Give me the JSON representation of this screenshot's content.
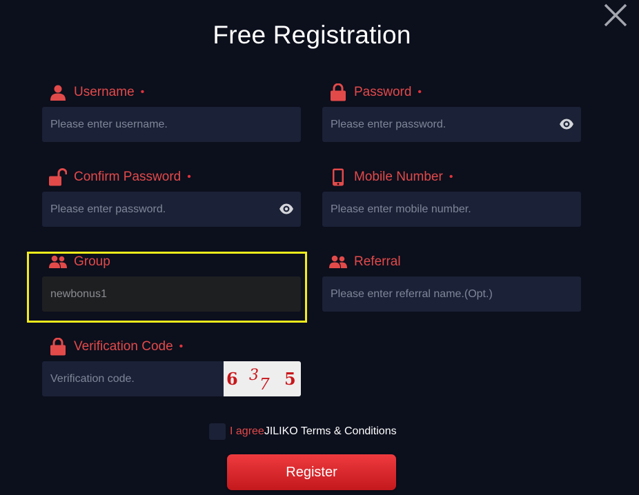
{
  "title": "Free Registration",
  "colors": {
    "background": "#0c0f1c",
    "input_bg": "#1b2136",
    "label": "#e24a4a",
    "highlight": "#f2ec1c",
    "button": "#d8262c"
  },
  "fields": {
    "username": {
      "label": "Username",
      "required": "•",
      "placeholder": "Please enter username.",
      "icon": "user-icon"
    },
    "password": {
      "label": "Password",
      "required": "•",
      "placeholder": "Please enter password.",
      "icon": "lock-icon"
    },
    "confirm_password": {
      "label": "Confirm Password",
      "required": "•",
      "placeholder": "Please enter password.",
      "icon": "unlock-icon"
    },
    "mobile": {
      "label": "Mobile Number",
      "required": "•",
      "placeholder": "Please enter mobile number.",
      "icon": "phone-icon"
    },
    "group": {
      "label": "Group",
      "value": "newbonus1",
      "icon": "users-icon"
    },
    "referral": {
      "label": "Referral",
      "placeholder": "Please enter referral name.(Opt.)",
      "icon": "users-icon"
    },
    "verification": {
      "label": "Verification Code",
      "required": "•",
      "placeholder": "Verification code.",
      "icon": "lock-icon"
    }
  },
  "captcha": {
    "digits": [
      "6",
      "3",
      "7",
      "5"
    ]
  },
  "agree": {
    "prefix": "I agree",
    "terms": "JILIKO Terms & Conditions"
  },
  "register_label": "Register"
}
